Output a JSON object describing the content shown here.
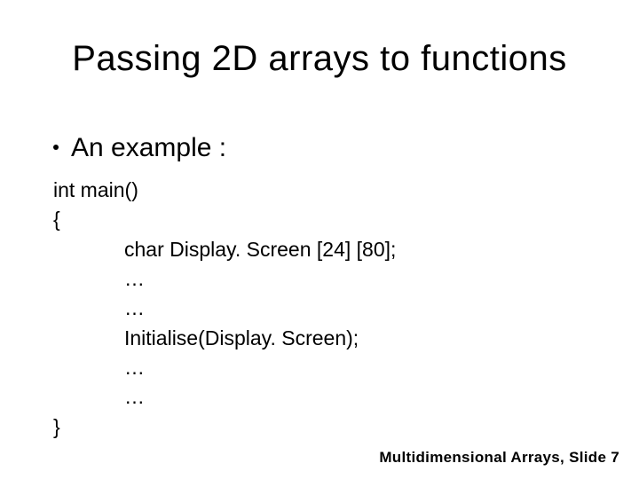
{
  "title": "Passing 2D arrays to functions",
  "subhead": "An example :",
  "code": {
    "l1": "int main()",
    "l2": "{",
    "l3": "char Display. Screen [24] [80];",
    "l4": "…",
    "l5": "…",
    "l6": "Initialise(Display. Screen);",
    "l7": "…",
    "l8": "…",
    "l9": "}"
  },
  "footer": "Multidimensional Arrays, Slide 7"
}
